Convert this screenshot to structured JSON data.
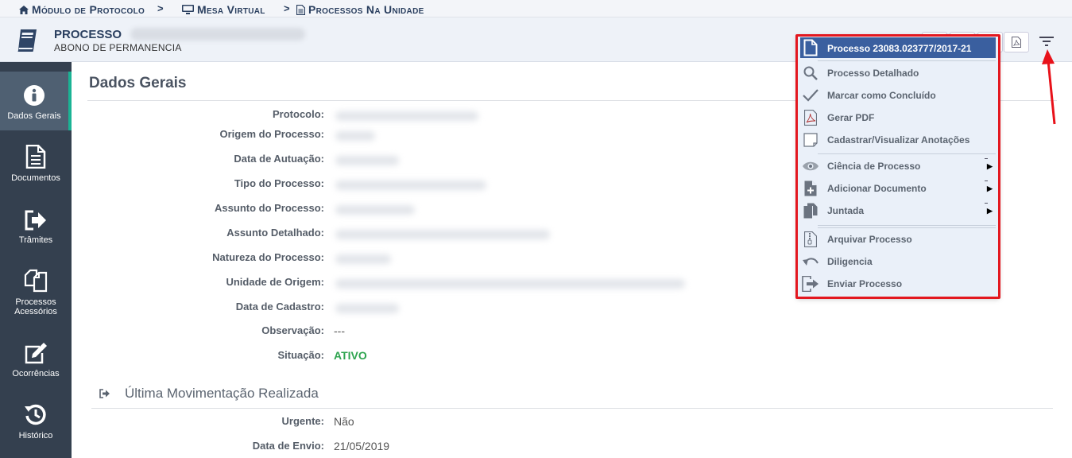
{
  "breadcrumb": {
    "items": [
      "Módulo de Protocolo",
      "Mesa Virtual",
      "Processos Na Unidade"
    ],
    "separator": ">"
  },
  "header": {
    "title": "PROCESSO",
    "subtitle": "ABONO DE PERMANENCIA"
  },
  "sidebar": {
    "items": [
      {
        "label": "Dados Gerais",
        "icon": "info-circle-icon"
      },
      {
        "label": "Documentos",
        "icon": "document-icon"
      },
      {
        "label": "Trâmites",
        "icon": "sign-out-icon"
      },
      {
        "label": "Processos Acessórios",
        "icon": "copy-icon"
      },
      {
        "label": "Ocorrências",
        "icon": "edit-icon"
      },
      {
        "label": "Histórico",
        "icon": "history-icon"
      }
    ]
  },
  "main": {
    "title": "Dados Gerais",
    "fields": [
      {
        "label": "Protocolo:",
        "value": ""
      },
      {
        "label": "Origem do Processo:",
        "value": ""
      },
      {
        "label": "Data de Autuação:",
        "value": ""
      },
      {
        "label": "Tipo do Processo:",
        "value": ""
      },
      {
        "label": "Assunto do Processo:",
        "value": ""
      },
      {
        "label": "Assunto Detalhado:",
        "value": ""
      },
      {
        "label": "Natureza do Processo:",
        "value": ""
      },
      {
        "label": "Unidade de Origem:",
        "value": ""
      },
      {
        "label": "Data de Cadastro:",
        "value": ""
      },
      {
        "label": "Observação:",
        "value": "---"
      },
      {
        "label": "Situação:",
        "value": "ATIVO"
      }
    ],
    "section2_title": "Última Movimentação Realizada",
    "section2_fields": [
      {
        "label": "Urgente:",
        "value": "Não"
      },
      {
        "label": "Data de Envio:",
        "value": "21/05/2019"
      }
    ]
  },
  "menu": {
    "header": "Processo 23083.023777/2017-21",
    "items": [
      "Processo Detalhado",
      "Marcar como Concluído",
      "Gerar PDF",
      "Cadastrar/Visualizar Anotações",
      "Ciência de Processo",
      "Adicionar Documento",
      "Juntada",
      "Arquivar Processo",
      "Diligencia",
      "Enviar Processo"
    ]
  },
  "colors": {
    "sidebar_bg": "#34404f",
    "active_accent": "#1ab394",
    "menu_header_bg": "#3a5f9f",
    "highlight_border": "#e3171f",
    "status_green": "#2ea44f"
  }
}
